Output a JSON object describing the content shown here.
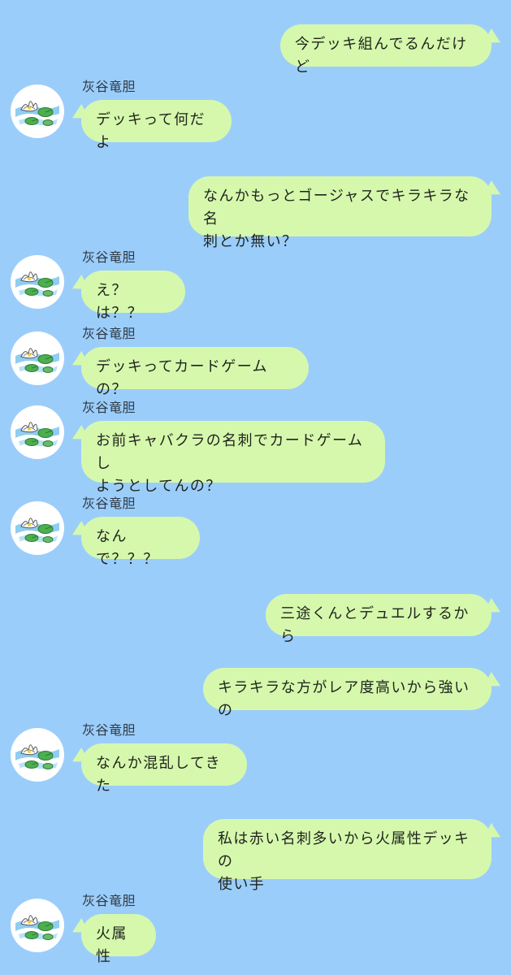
{
  "colors": {
    "background": "#9bcdfb",
    "bubble": "#d6f8ad",
    "text": "#1e241c",
    "name": "#2f3a44"
  },
  "contact": {
    "name": "灰谷竜胆",
    "avatar_icon": "water-lily-icon"
  },
  "messages": [
    {
      "side": "right",
      "text": "今デッキ組んでるんだけど"
    },
    {
      "side": "left",
      "sender": "灰谷竜胆",
      "text": "デッキって何だよ"
    },
    {
      "side": "right",
      "text": "なんかもっとゴージャスでキラキラな名\n刺とか無い？"
    },
    {
      "side": "left",
      "sender": "灰谷竜胆",
      "text": "え？は？？"
    },
    {
      "side": "left",
      "sender": "灰谷竜胆",
      "text": "デッキってカードゲームの？"
    },
    {
      "side": "left",
      "sender": "灰谷竜胆",
      "text": "お前キャバクラの名刺でカードゲームし\nようとしてんの？"
    },
    {
      "side": "left",
      "sender": "灰谷竜胆",
      "text": "なんで？？？"
    },
    {
      "side": "right",
      "text": "三途くんとデュエルするから"
    },
    {
      "side": "right",
      "text": "キラキラな方がレア度高いから強いの"
    },
    {
      "side": "left",
      "sender": "灰谷竜胆",
      "text": "なんか混乱してきた"
    },
    {
      "side": "right",
      "text": "私は赤い名刺多いから火属性デッキの\n使い手"
    },
    {
      "side": "left",
      "sender": "灰谷竜胆",
      "text": "火属性"
    }
  ]
}
